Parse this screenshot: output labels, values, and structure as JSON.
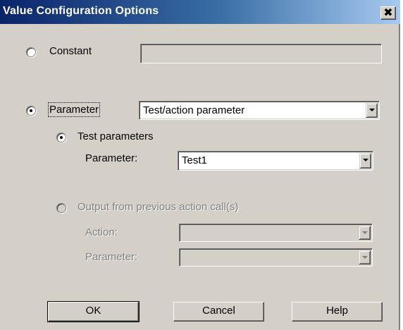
{
  "dialog": {
    "title": "Value Configuration Options",
    "close_glyph": "✖"
  },
  "constant": {
    "label": "Constant",
    "value": "",
    "selected": false
  },
  "parameter": {
    "label": "Parameter",
    "selected": true,
    "type_value": "Test/action parameter"
  },
  "test_parameters": {
    "label": "Test parameters",
    "selected": true,
    "param_label": "Parameter:",
    "param_value": "Test1"
  },
  "output_previous": {
    "label": "Output from previous action call(s)",
    "selected": false,
    "enabled": false,
    "action_label": "Action:",
    "action_value": "",
    "param_label": "Parameter:",
    "param_value": ""
  },
  "buttons": {
    "ok": "OK",
    "cancel": "Cancel",
    "help": "Help"
  },
  "icons": {
    "close": "close-icon",
    "dropdown": "chevron-down-icon"
  },
  "colors": {
    "title_start": "#0a246a",
    "title_end": "#a6caf0",
    "face": "#d4d0c8",
    "disabled_text": "#808080"
  }
}
